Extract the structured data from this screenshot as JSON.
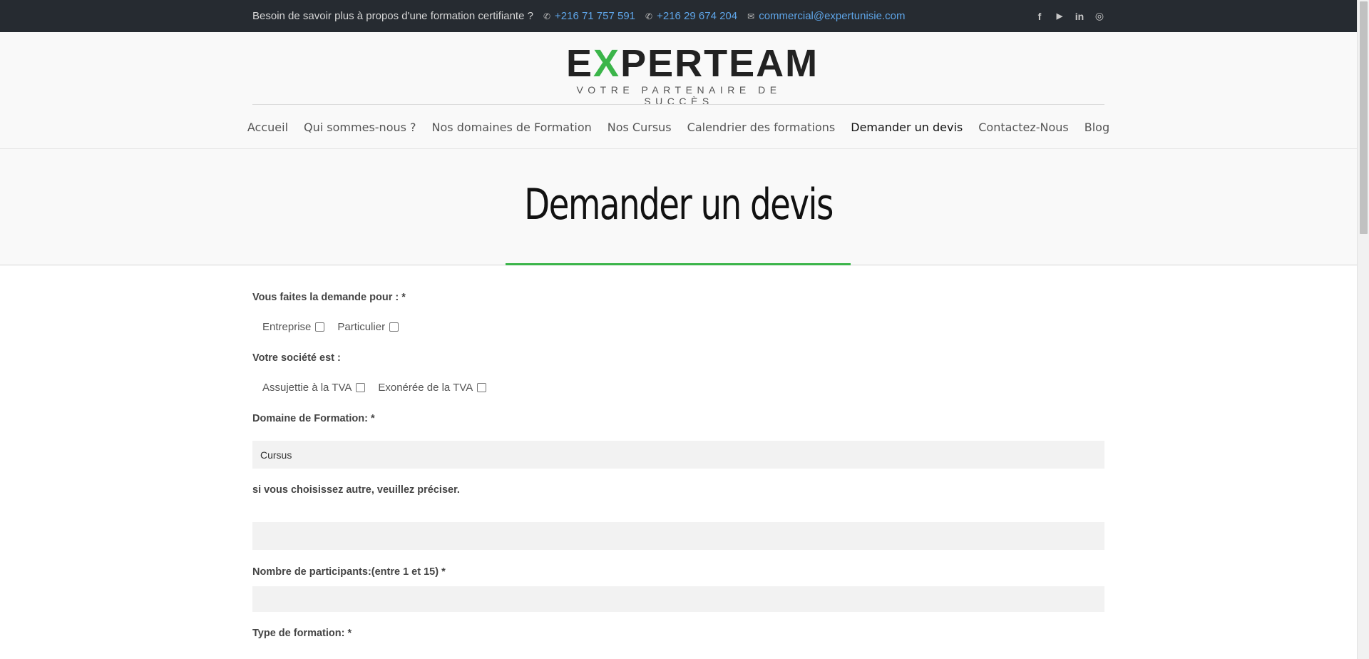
{
  "topbar": {
    "tagline": "Besoin de savoir plus à propos d'une formation certifiante ?",
    "phone1": "+216 71 757 591",
    "phone2": "+216 29 674 204",
    "email": "commercial@expertunisie.com",
    "social_icons": [
      "facebook-icon",
      "youtube-icon",
      "linkedin-icon",
      "instagram-icon"
    ]
  },
  "logo": {
    "word_pre": "E",
    "word_x": "X",
    "word_post": "PERTEAM",
    "tagline": "VOTRE PARTENAIRE DE SUCCÈS",
    "accent_color": "#3bb54a"
  },
  "nav": {
    "items": [
      "Accueil",
      "Qui sommes-nous ?",
      "Nos domaines de Formation",
      "Nos Cursus",
      "Calendrier des formations",
      "Demander un devis",
      "Contactez-Nous",
      "Blog"
    ],
    "active": "Demander un devis"
  },
  "page": {
    "title": "Demander un devis"
  },
  "form": {
    "demande_label": "Vous faites la demande pour : *",
    "demande_opt1": "Entreprise",
    "demande_opt2": "Particulier",
    "societe_label": "Votre société est :",
    "societe_opt1": "Assujettie à la TVA",
    "societe_opt2": "Exonérée de la TVA",
    "domaine_label": "Domaine de Formation: *",
    "domaine_value": "Cursus",
    "autre_label": "si vous choisissez autre, veuillez préciser.",
    "autre_value": "",
    "participants_label": "Nombre de participants:(entre 1 et 15) *",
    "participants_value": "",
    "type_label": "Type de formation: *"
  }
}
